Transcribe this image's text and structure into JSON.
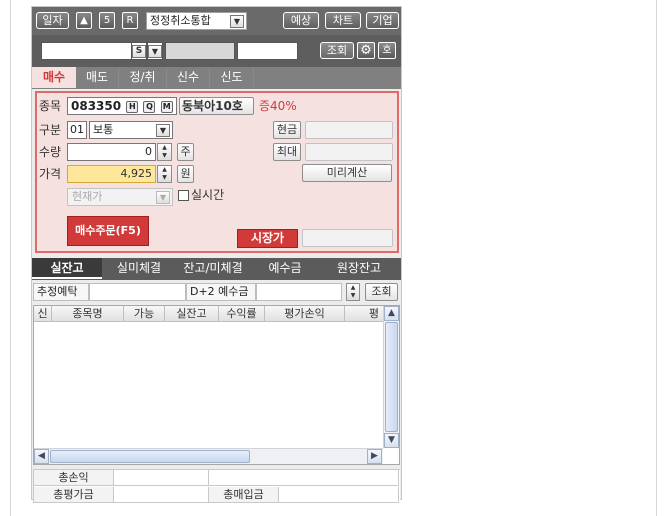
{
  "toolbar": {
    "date_label": "일자",
    "up_label": "▲",
    "s_label": "5",
    "r_label": "R",
    "mode_select": "정정취소통합",
    "forecast_label": "예상",
    "chart_label": "차트",
    "company_label": "기업"
  },
  "account": {
    "s_label": "S",
    "query_label": "조회",
    "call_label": "호"
  },
  "tabs": [
    "매수",
    "매도",
    "정/취",
    "신수",
    "신도"
  ],
  "order": {
    "stock_label": "종목",
    "stock_code": "083350",
    "h_label": "H",
    "q_label": "Q",
    "m_label": "M",
    "stock_name": "동북아10호",
    "margin_rate": "증40%",
    "type_label": "구분",
    "type_code": "01",
    "type_value": "보통",
    "cash_label": "현금",
    "qty_label": "수량",
    "qty_value": "0",
    "qty_unit": "주",
    "max_label": "최대",
    "price_label": "가격",
    "price_value": "4,925",
    "price_unit": "원",
    "calc_label": "미리계산",
    "current_price_label": "현재가",
    "realtime_label": "실시간",
    "buy_button": "매수주문(F5)",
    "market_price_button": "시장가"
  },
  "bottom_tabs": [
    "실잔고",
    "실미체결",
    "잔고/미체결",
    "예수금",
    "원장잔고"
  ],
  "balance": {
    "est_deposit_label": "추정예탁",
    "d2_label": "D+2 예수금",
    "query_label": "조회",
    "columns": [
      "신",
      "종목명",
      "가능",
      "실잔고",
      "수익률",
      "평가손익"
    ],
    "column_cut": "평",
    "rows": []
  },
  "summary": {
    "total_pl_label": "총손익",
    "total_eval_label": "총평가금",
    "total_buy_label": "총매입금"
  },
  "colors": {
    "accent_red": "#d23a3a",
    "price_highlight": "#fde79a",
    "panel_pink": "#f6e1e1"
  }
}
